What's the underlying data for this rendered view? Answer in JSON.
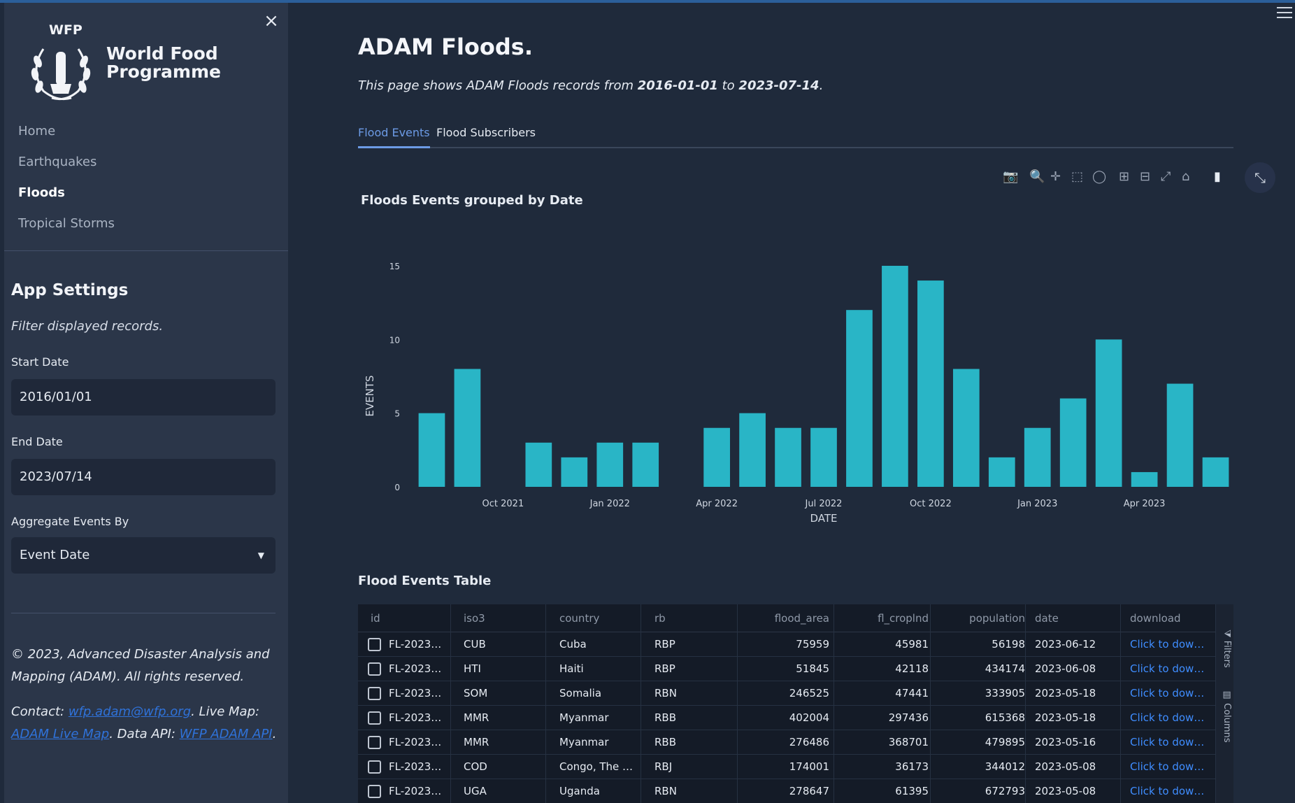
{
  "sidebar": {
    "close_label": "×",
    "logo": {
      "abbr": "WFP",
      "name_line1": "World Food",
      "name_line2": "Programme"
    },
    "nav": [
      {
        "label": "Home",
        "active": false
      },
      {
        "label": "Earthquakes",
        "active": false
      },
      {
        "label": "Floods",
        "active": true
      },
      {
        "label": "Tropical Storms",
        "active": false
      }
    ],
    "settings_title": "App Settings",
    "settings_subtitle": "Filter displayed records.",
    "start_date_label": "Start Date",
    "start_date_value": "2016/01/01",
    "end_date_label": "End Date",
    "end_date_value": "2023/07/14",
    "aggregate_label": "Aggregate Events By",
    "aggregate_value": "Event Date",
    "footer": {
      "copyright": "© 2023, Advanced Disaster Analysis and Mapping (ADAM). All rights reserved.",
      "contact_prefix": "Contact: ",
      "contact_email": "wfp.adam@wfp.org",
      "live_map_prefix": ". Live Map: ",
      "live_map_link": "ADAM Live Map",
      "api_prefix": ". Data API: ",
      "api_link": "WFP ADAM API",
      "suffix": "."
    }
  },
  "header": {
    "title": "ADAM Floods.",
    "subtitle_prefix": "This page shows ADAM Floods records from ",
    "date_from": "2016-01-01",
    "subtitle_mid": " to ",
    "date_to": "2023-07-14",
    "subtitle_suffix": "."
  },
  "tabs": [
    {
      "label": "Flood Events",
      "active": true
    },
    {
      "label": "Flood Subscribers",
      "active": false
    }
  ],
  "modebar": {
    "icons": [
      "camera-icon",
      "zoom-icon",
      "pan-icon",
      "box-select-icon",
      "lasso-icon",
      "zoom-in-icon",
      "zoom-out-icon",
      "autoscale-icon",
      "reset-axes-icon",
      "plotly-logo-icon"
    ],
    "glyphs": [
      "📷",
      "🔍",
      "✛",
      "⬚",
      "◯",
      "⊞",
      "⊟",
      "⤢",
      "⌂",
      "▮"
    ],
    "expand_glyph": "⤡"
  },
  "chart_title": "Floods Events grouped by Date",
  "chart_data": {
    "type": "bar",
    "x": [
      "2021-08",
      "2021-09",
      "2021-11",
      "2021-12",
      "2022-01",
      "2022-02",
      "2022-04",
      "2022-05",
      "2022-06",
      "2022-07",
      "2022-08",
      "2022-09",
      "2022-10",
      "2022-11",
      "2022-12",
      "2023-01",
      "2023-02",
      "2023-03",
      "2023-04",
      "2023-05",
      "2023-06"
    ],
    "values": [
      5,
      8,
      3,
      2,
      3,
      3,
      4,
      5,
      4,
      4,
      12,
      15,
      14,
      8,
      2,
      4,
      6,
      10,
      1,
      7,
      2
    ],
    "xlabel": "DATE",
    "ylabel": "EVENTS",
    "ylim": [
      0,
      15
    ],
    "yticks": [
      0,
      5,
      10,
      15
    ],
    "xticks": [
      {
        "label": "Oct 2021",
        "at": "2021-10"
      },
      {
        "label": "Jan 2022",
        "at": "2022-01"
      },
      {
        "label": "Apr 2022",
        "at": "2022-04"
      },
      {
        "label": "Jul 2022",
        "at": "2022-07"
      },
      {
        "label": "Oct 2022",
        "at": "2022-10"
      },
      {
        "label": "Jan 2023",
        "at": "2023-01"
      },
      {
        "label": "Apr 2023",
        "at": "2023-04"
      }
    ],
    "color": "#29b5c6"
  },
  "table": {
    "title": "Flood Events Table",
    "columns": [
      "id",
      "iso3",
      "country",
      "rb",
      "flood_area",
      "fl_croplnd",
      "population",
      "date",
      "download"
    ],
    "rows": [
      [
        "FL-2023…",
        "CUB",
        "Cuba",
        "RBP",
        "75959",
        "45981",
        "56198",
        "2023-06-12",
        "Click to dow…"
      ],
      [
        "FL-2023…",
        "HTI",
        "Haiti",
        "RBP",
        "51845",
        "42118",
        "434174",
        "2023-06-08",
        "Click to dow…"
      ],
      [
        "FL-2023…",
        "SOM",
        "Somalia",
        "RBN",
        "246525",
        "47441",
        "333905",
        "2023-05-18",
        "Click to dow…"
      ],
      [
        "FL-2023…",
        "MMR",
        "Myanmar",
        "RBB",
        "402004",
        "297436",
        "615368",
        "2023-05-18",
        "Click to dow…"
      ],
      [
        "FL-2023…",
        "MMR",
        "Myanmar",
        "RBB",
        "276486",
        "368701",
        "479895",
        "2023-05-16",
        "Click to dow…"
      ],
      [
        "FL-2023…",
        "COD",
        "Congo, The …",
        "RBJ",
        "174001",
        "36173",
        "344012",
        "2023-05-08",
        "Click to dow…"
      ],
      [
        "FL-2023…",
        "UGA",
        "Uganda",
        "RBN",
        "278647",
        "61395",
        "672793",
        "2023-05-08",
        "Click to dow…"
      ]
    ],
    "side_buttons": [
      "⧩ Filters",
      "▤ Columns"
    ]
  }
}
